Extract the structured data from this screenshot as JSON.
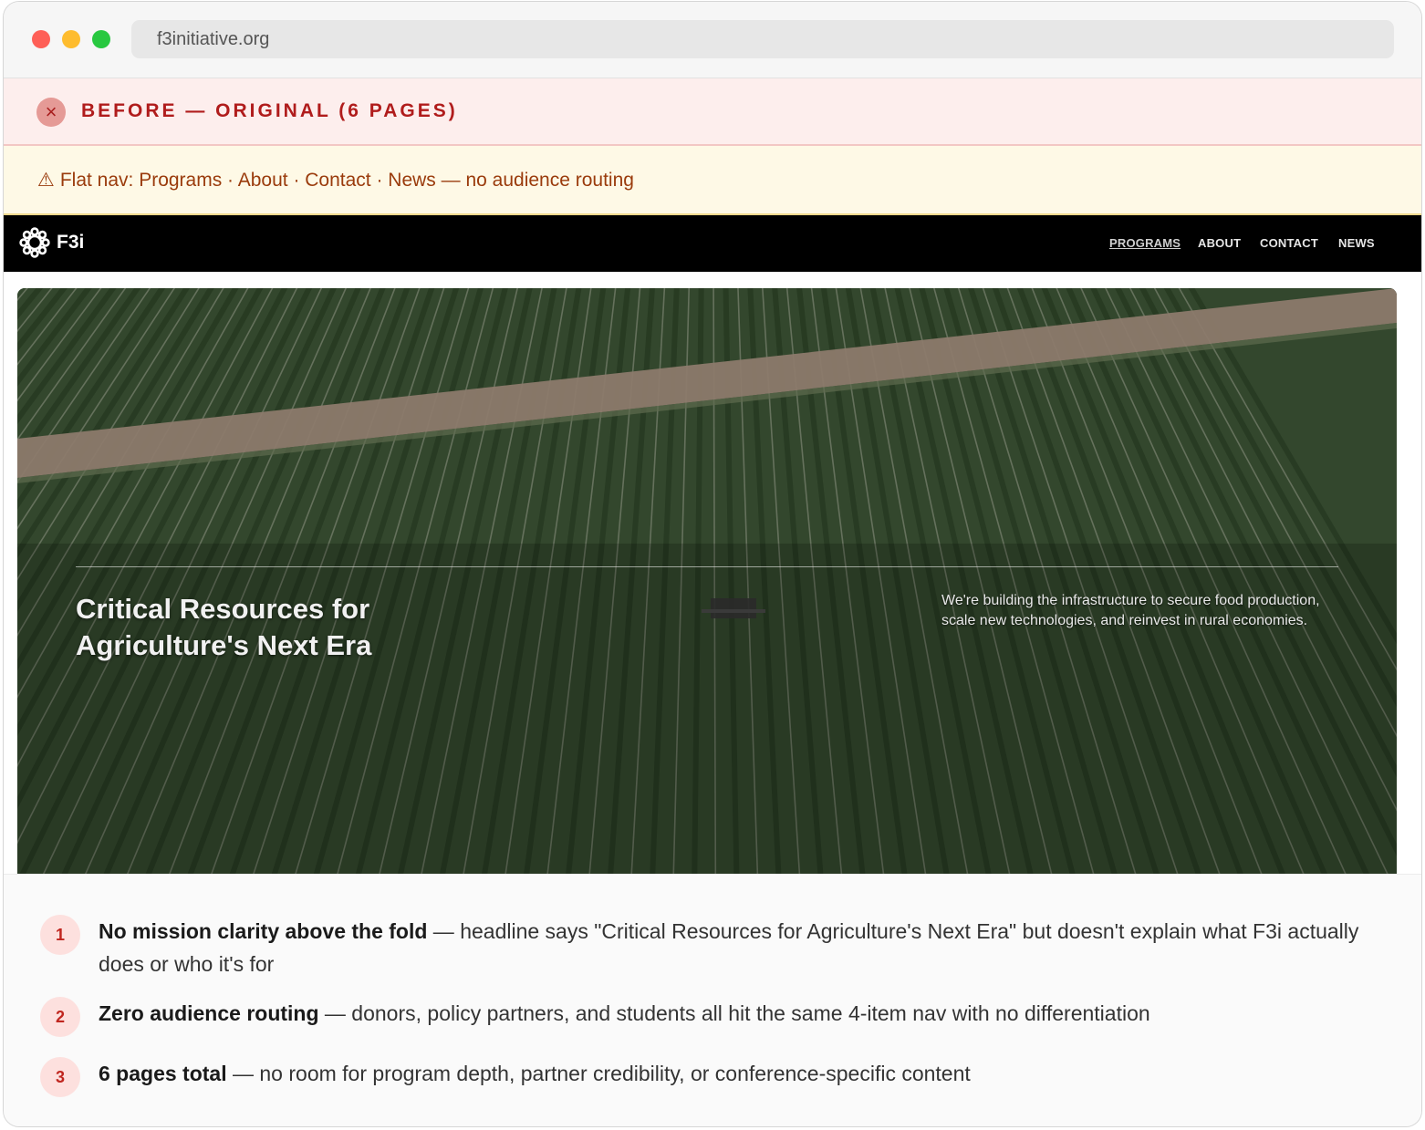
{
  "browser": {
    "url": "f3initiative.org"
  },
  "before_banner": {
    "label": "BEFORE — ORIGINAL (6 PAGES)",
    "icon": "close-icon"
  },
  "warning": {
    "icon": "warning-triangle-icon",
    "glyph": "⚠",
    "text": "Flat nav: Programs · About · Contact · News — no audience routing"
  },
  "site": {
    "logo_text": "F3i",
    "nav": [
      {
        "label": "PROGRAMS",
        "active": true
      },
      {
        "label": "ABOUT",
        "active": false
      },
      {
        "label": "CONTACT",
        "active": false
      },
      {
        "label": "NEWS",
        "active": false
      }
    ],
    "hero": {
      "headline": "Critical Resources for Agriculture's Next Era",
      "subtext": "We're building the infrastructure to secure food production, scale new technologies, and reinvest in rural economies."
    }
  },
  "notes": [
    {
      "number": "1",
      "bold": "No mission clarity above the fold",
      "text": " — headline says \"Critical Resources for Agriculture's Next Era\" but doesn't explain what F3i actually does or who it's for"
    },
    {
      "number": "2",
      "bold": "Zero audience routing",
      "text": " — donors, policy partners, and students all hit the same 4-item nav with no differentiation"
    },
    {
      "number": "3",
      "bold": "6 pages total",
      "text": " — no room for program depth, partner credibility, or conference-specific content"
    }
  ],
  "colors": {
    "before_bg": "#fdeeed",
    "before_text": "#b01c1c",
    "warn_bg": "#fef9e6",
    "warn_text": "#9a3b0c",
    "field_green": "#33472d",
    "road": "#8c7a6c"
  }
}
